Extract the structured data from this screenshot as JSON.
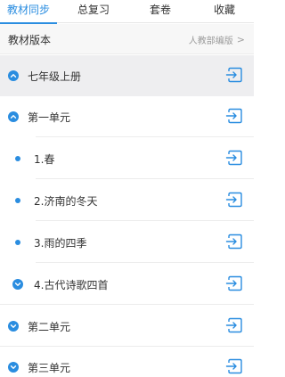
{
  "tabs": [
    {
      "label": "教材同步",
      "active": true
    },
    {
      "label": "总复习",
      "active": false
    },
    {
      "label": "套卷",
      "active": false
    },
    {
      "label": "收藏",
      "active": false
    }
  ],
  "edition": {
    "label": "教材版本",
    "value": "人教部编版",
    "chevron": ">"
  },
  "tree": {
    "grade": {
      "label": "七年级上册",
      "icon": "chevron-up-icon"
    },
    "unit1": {
      "label": "第一单元",
      "icon": "chevron-up-icon"
    },
    "lessons": [
      {
        "label": "1.春",
        "icon": "dot-icon"
      },
      {
        "label": "2.济南的冬天",
        "icon": "dot-icon"
      },
      {
        "label": "3.雨的四季",
        "icon": "dot-icon"
      },
      {
        "label": "4.古代诗歌四首",
        "icon": "chevron-down-icon"
      }
    ],
    "unit2": {
      "label": "第二单元",
      "icon": "chevron-down-icon"
    },
    "unit3": {
      "label": "第三单元",
      "icon": "chevron-down-icon"
    }
  },
  "colors": {
    "accent": "#2a8de0",
    "grade_row_bg": "#eeeef0",
    "text": "#333333",
    "muted": "#9a9a9a"
  }
}
